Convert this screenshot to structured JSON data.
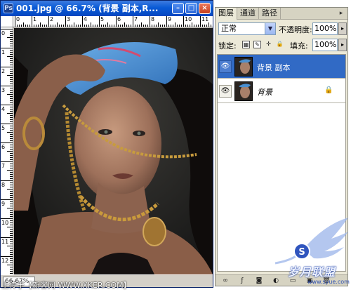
{
  "document": {
    "title": "001.jpg @ 66.7% (背景 副本,R...",
    "app_icon": "photoshop-icon",
    "buttons": {
      "minimize": "–",
      "maximize": "□",
      "close": "×"
    },
    "ruler_top_marks": [
      "0",
      "1",
      "2",
      "3",
      "4",
      "5",
      "6",
      "7",
      "8",
      "9",
      "10",
      "11"
    ],
    "ruler_left_marks": [
      "0",
      "1",
      "2",
      "3",
      "4",
      "5",
      "6",
      "7",
      "8",
      "9",
      "10",
      "11",
      "12"
    ],
    "zoom_status": "66.67%"
  },
  "layers_panel": {
    "tabs": [
      "图层",
      "通道",
      "路径"
    ],
    "active_tab": 0,
    "blend_mode": "正常",
    "opacity_label": "不透明度:",
    "opacity_value": "100%",
    "lock_label": "锁定:",
    "fill_label": "填充:",
    "fill_value": "100%",
    "layers": [
      {
        "name": "背景 副本",
        "selected": true,
        "visible_icon": "eye-icon",
        "locked": false,
        "italic": false
      },
      {
        "name": "背景",
        "selected": false,
        "visible_icon": "eye-icon",
        "locked": true,
        "italic": true
      }
    ],
    "bottom_icons": [
      "link-icon",
      "fx-icon",
      "mask-icon",
      "adjustment-icon",
      "folder-icon",
      "new-layer-icon",
      "trash-icon"
    ]
  },
  "watermark": {
    "credit": "上传于【新客网 WWW.XKER.COM】",
    "brand": "岁月联盟",
    "url": "www.syue.com",
    "logo_letter": "S"
  },
  "colors": {
    "title_bar": "#0a5ad6",
    "selected_layer": "#316ac5",
    "panel_bg": "#ece9d8",
    "bandana": "#4a8fd0"
  }
}
